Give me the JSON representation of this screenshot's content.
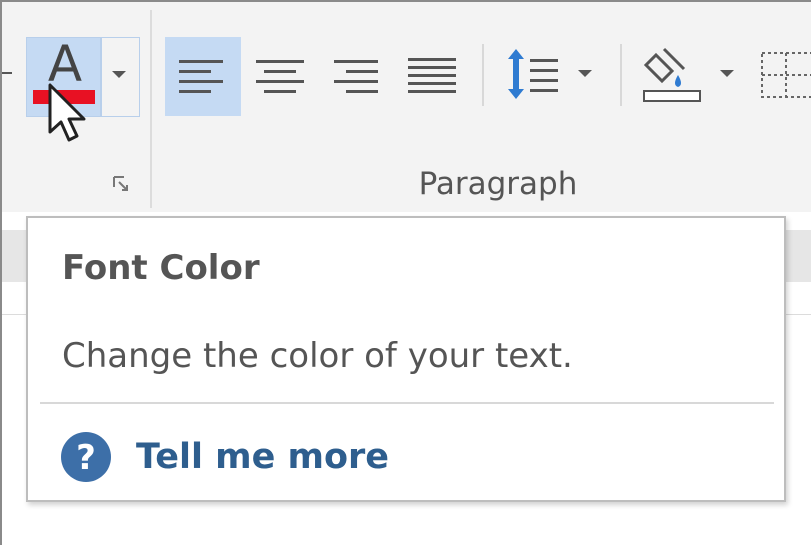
{
  "ribbon": {
    "font_group": {
      "font_color_button": {
        "glyph": "A",
        "color_swatch": "#e81123",
        "active": true
      },
      "dropdown": {
        "icon": "caret-down-icon"
      },
      "launcher": {
        "icon": "dialog-launcher-icon"
      }
    },
    "paragraph_group": {
      "label": "Paragraph",
      "buttons": [
        {
          "name": "align-left",
          "icon": "align-left-icon",
          "active": true
        },
        {
          "name": "align-center",
          "icon": "align-center-icon",
          "active": false
        },
        {
          "name": "align-right",
          "icon": "align-right-icon",
          "active": false
        },
        {
          "name": "justify",
          "icon": "justify-icon",
          "active": false
        },
        {
          "name": "line-spacing",
          "icon": "line-spacing-icon",
          "active": false
        },
        {
          "name": "shading",
          "icon": "shading-bucket-icon",
          "active": false
        },
        {
          "name": "borders",
          "icon": "borders-icon",
          "active": false
        }
      ]
    }
  },
  "tooltip": {
    "title": "Font Color",
    "description": "Change the color of your text.",
    "link_label": "Tell me more",
    "link_icon": "help-circle-icon",
    "link_color": "#2e5e8e",
    "icon_color": "#3d6fa8"
  },
  "colors": {
    "accent_selected": "#c5daf3",
    "text_gray": "#555555",
    "line_spacing_arrow": "#2f7bd1"
  }
}
